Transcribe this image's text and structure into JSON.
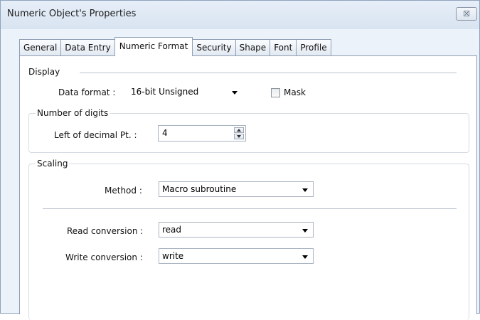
{
  "window": {
    "title": "Numeric Object's Properties",
    "close_glyph": "☒"
  },
  "tabs": [
    {
      "label": "General"
    },
    {
      "label": "Data Entry"
    },
    {
      "label": "Numeric Format"
    },
    {
      "label": "Security"
    },
    {
      "label": "Shape"
    },
    {
      "label": "Font"
    },
    {
      "label": "Profile"
    }
  ],
  "active_tab": "Numeric Format",
  "display": {
    "section_label": "Display",
    "data_format_label": "Data format :",
    "data_format_value": "16-bit Unsigned",
    "mask_label": "Mask",
    "mask_checked": false
  },
  "digits": {
    "group_label": "Number of digits",
    "left_label": "Left of decimal Pt. :",
    "left_value": "4"
  },
  "scaling": {
    "group_label": "Scaling",
    "method_label": "Method :",
    "method_value": "Macro subroutine",
    "read_label": "Read conversion :",
    "read_value": "read",
    "write_label": "Write conversion :",
    "write_value": "write"
  }
}
